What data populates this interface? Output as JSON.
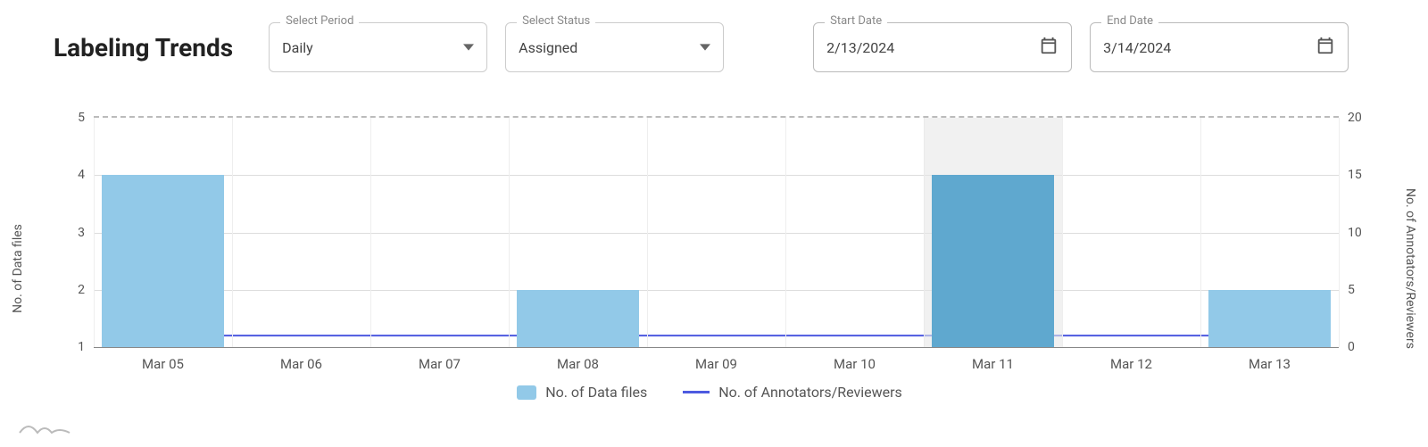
{
  "header": {
    "title": "Labeling Trends",
    "period": {
      "label": "Select Period",
      "value": "Daily"
    },
    "status": {
      "label": "Select Status",
      "value": "Assigned"
    },
    "start": {
      "label": "Start Date",
      "value": "2/13/2024"
    },
    "end": {
      "label": "End Date",
      "value": "3/14/2024"
    }
  },
  "chart_data": {
    "type": "bar",
    "categories": [
      "Mar 05",
      "Mar 06",
      "Mar 07",
      "Mar 08",
      "Mar 09",
      "Mar 10",
      "Mar 11",
      "Mar 12",
      "Mar 13"
    ],
    "series": [
      {
        "name": "No. of Data files",
        "kind": "bar",
        "axis": "left",
        "values": [
          4,
          0,
          0,
          2,
          0,
          0,
          4,
          0,
          2
        ]
      },
      {
        "name": "No. of Annotators/Reviewers",
        "kind": "line",
        "axis": "right",
        "values": [
          1,
          1,
          1,
          1,
          1,
          1,
          1,
          1,
          1
        ]
      }
    ],
    "highlight_index": 6,
    "title": "Labeling Trends",
    "xlabel": "",
    "ylabel_left": "No. of Data files",
    "ylabel_right": "No. of Annotators/Reviewers",
    "ylim_left": [
      1,
      5
    ],
    "ylim_right": [
      0,
      20
    ],
    "y_left_ticks": [
      1,
      2,
      3,
      4,
      5
    ],
    "y_right_ticks": [
      0,
      5,
      10,
      15,
      20
    ],
    "colors": {
      "bar": "#92c9e8",
      "bar_highlight": "#5fa8cf",
      "line": "#4d5ae0"
    }
  },
  "legend": {
    "bar": "No. of Data files",
    "line": "No. of Annotators/Reviewers"
  }
}
